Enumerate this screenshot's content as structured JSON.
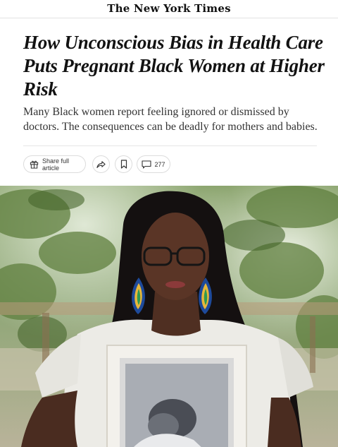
{
  "masthead": {
    "logo_text": "The New York Times"
  },
  "article": {
    "headline": "How Unconscious Bias in Health Care Puts Pregnant Black Women at Higher Risk",
    "summary": "Many Black women report feeling ignored or dismissed by doctors. The consequences can be deadly for mothers and babies."
  },
  "actions": {
    "share_full_label": "Share full article",
    "comment_count": "277",
    "icons": [
      "gift-icon",
      "share-icon",
      "bookmark-icon",
      "comment-icon"
    ]
  },
  "colors": {
    "text": "#121212",
    "summary_text": "#333333",
    "divider": "#e6e6e6",
    "photo_foliage": "#6f8f4a"
  }
}
